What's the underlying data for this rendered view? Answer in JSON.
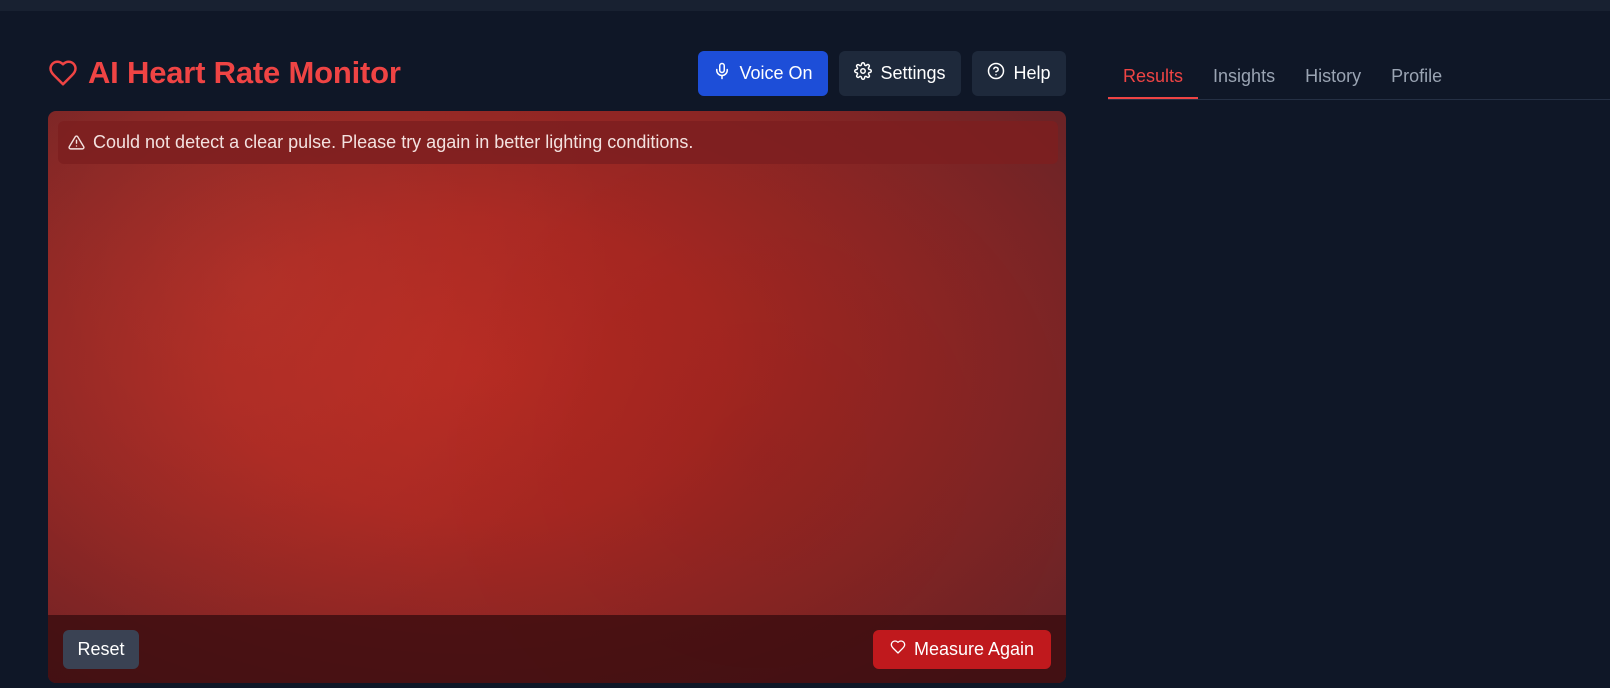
{
  "app": {
    "title": "AI Heart Rate Monitor"
  },
  "header": {
    "voice_label": "Voice On",
    "settings_label": "Settings",
    "help_label": "Help"
  },
  "camera": {
    "alert_message": "Could not detect a clear pulse. Please try again in better lighting conditions.",
    "reset_label": "Reset",
    "measure_label": "Measure Again"
  },
  "tabs": [
    {
      "label": "Results",
      "active": true
    },
    {
      "label": "Insights",
      "active": false
    },
    {
      "label": "History",
      "active": false
    },
    {
      "label": "Profile",
      "active": false
    }
  ],
  "colors": {
    "background": "#0f1727",
    "brand_red": "#ef4444",
    "voice_blue": "#1d4ed8",
    "secondary_button": "#1e293b",
    "measure_red": "#c0191d"
  },
  "icons": {
    "brand": "heart-icon",
    "voice": "microphone-icon",
    "settings": "gear-icon",
    "help": "help-circle-icon",
    "alert": "warning-icon",
    "measure": "heart-icon"
  }
}
